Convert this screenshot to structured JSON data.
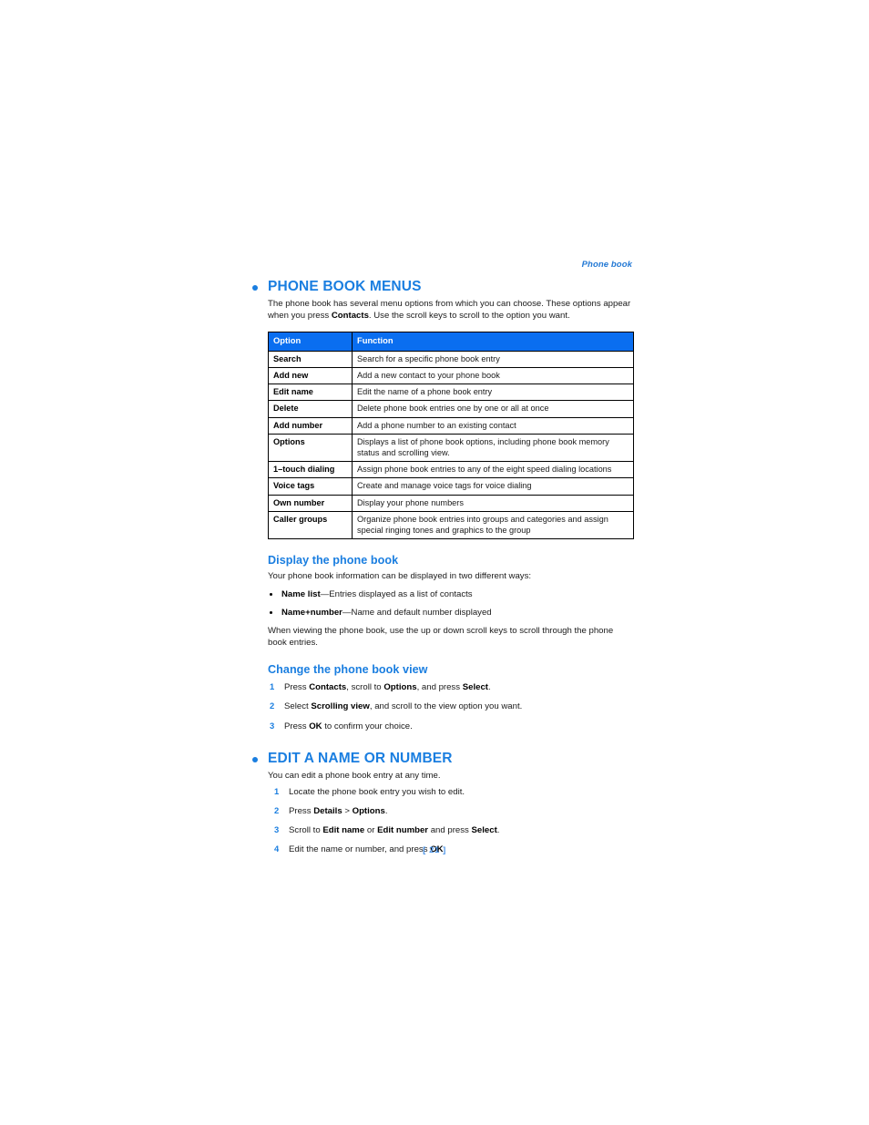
{
  "running_head": "Phone book",
  "folio": "[ 21 ]",
  "colors": {
    "accent_blue": "#1a7ee0",
    "table_header_blue": "#0a6ef0",
    "running_head_blue": "#2278d4",
    "folio_blue": "#4d95e8",
    "body_text": "#1a1a1a"
  },
  "sections": [
    {
      "id": "phone-book-menus",
      "title": "PHONE BOOK MENUS",
      "intro_parts": [
        "The phone book has several menu options from which you can choose. These options appear when you press ",
        "Contacts",
        ". Use the scroll keys to scroll to the option you want."
      ],
      "table": {
        "headers": [
          "Option",
          "Function"
        ],
        "rows": [
          [
            "Search",
            "Search for a specific phone book entry"
          ],
          [
            "Add new",
            "Add a new contact to your phone book"
          ],
          [
            "Edit name",
            "Edit the name of a phone book entry"
          ],
          [
            "Delete",
            "Delete phone book entries one by one or all at once"
          ],
          [
            "Add number",
            "Add a phone number to an existing contact"
          ],
          [
            "Options",
            "Displays a list of phone book options, including phone book memory status and scrolling view."
          ],
          [
            "1–touch dialing",
            "Assign phone book entries to any of the eight speed dialing locations"
          ],
          [
            "Voice tags",
            "Create and manage voice tags for voice dialing"
          ],
          [
            "Own number",
            "Display your phone numbers"
          ],
          [
            "Caller groups",
            "Organize phone book entries into groups and categories and assign special ringing tones and graphics to the group"
          ]
        ]
      }
    },
    {
      "id": "display-the-phone-book",
      "title": "Display the phone book",
      "intro": "Your phone book information can be displayed in two different ways:",
      "bullets": [
        {
          "bold": "Name list",
          "rest": "—Entries displayed as a list of contacts"
        },
        {
          "bold": "Name+number",
          "rest": "—Name and default number displayed"
        }
      ],
      "closing": "When viewing the phone book, use the up or down scroll keys to scroll through the phone book entries."
    },
    {
      "id": "change-the-phone-book-view",
      "title": "Change the phone book view",
      "steps": [
        {
          "num": "1",
          "p1": "Press ",
          "b1": "Contacts",
          "p2": ", scroll to ",
          "b2": "Options",
          "p3": ", and press ",
          "b3": "Select",
          "p4": "."
        },
        {
          "num": "2",
          "p1": "Select ",
          "b1": "Scrolling view",
          "p2": ", and scroll to the view option you want.",
          "b2": "",
          "p3": "",
          "b3": "",
          "p4": ""
        },
        {
          "num": "3",
          "p1": "Press ",
          "b1": "OK",
          "p2": " to confirm your choice.",
          "b2": "",
          "p3": "",
          "b3": "",
          "p4": ""
        }
      ]
    },
    {
      "id": "edit-a-name-or-number",
      "title": "EDIT A NAME OR NUMBER",
      "intro": "You can edit a phone book entry at any time.",
      "steps": [
        {
          "num": "1",
          "p1": "Locate the phone book entry you wish to edit.",
          "b1": "",
          "p2": "",
          "b2": "",
          "p3": "",
          "b3": "",
          "p4": ""
        },
        {
          "num": "2",
          "p1": "Press ",
          "b1": "Details",
          "p2": " > ",
          "b2": "Options",
          "p3": ".",
          "b3": "",
          "p4": ""
        },
        {
          "num": "3",
          "p1": "Scroll to ",
          "b1": "Edit name",
          "p2": " or ",
          "b2": "Edit number",
          "p3": " and press ",
          "b3": "Select",
          "p4": "."
        },
        {
          "num": "4",
          "p1": "Edit the name or number, and press ",
          "b1": "OK",
          "p2": ".",
          "b2": "",
          "p3": "",
          "b3": "",
          "p4": ""
        }
      ]
    }
  ]
}
